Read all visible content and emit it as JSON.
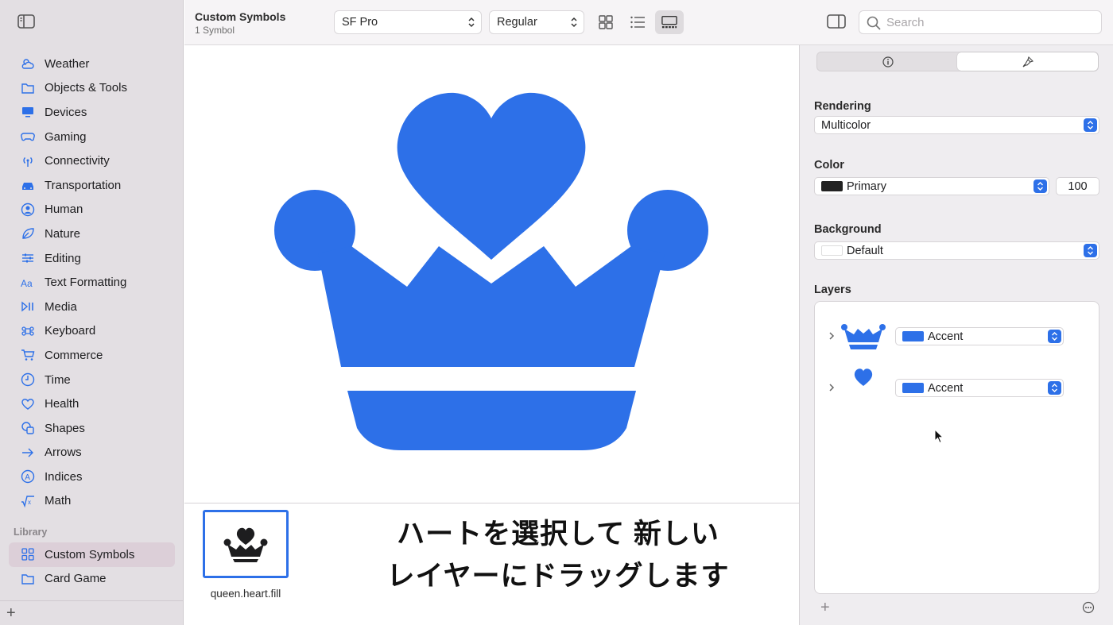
{
  "sidebar": {
    "categories": [
      {
        "label": "Weather",
        "icon": "cloud-sun-icon"
      },
      {
        "label": "Objects & Tools",
        "icon": "folder-icon"
      },
      {
        "label": "Devices",
        "icon": "desktop-icon"
      },
      {
        "label": "Gaming",
        "icon": "gamecontroller-icon"
      },
      {
        "label": "Connectivity",
        "icon": "antenna-icon"
      },
      {
        "label": "Transportation",
        "icon": "car-icon"
      },
      {
        "label": "Human",
        "icon": "person-circle-icon"
      },
      {
        "label": "Nature",
        "icon": "leaf-icon"
      },
      {
        "label": "Editing",
        "icon": "sliders-icon"
      },
      {
        "label": "Text Formatting",
        "icon": "text-aa-icon"
      },
      {
        "label": "Media",
        "icon": "play-pause-icon"
      },
      {
        "label": "Keyboard",
        "icon": "command-icon"
      },
      {
        "label": "Commerce",
        "icon": "cart-icon"
      },
      {
        "label": "Time",
        "icon": "clock-icon"
      },
      {
        "label": "Health",
        "icon": "heart-icon"
      },
      {
        "label": "Shapes",
        "icon": "shapes-icon"
      },
      {
        "label": "Arrows",
        "icon": "arrow-right-icon"
      },
      {
        "label": "Indices",
        "icon": "a-circle-icon"
      },
      {
        "label": "Math",
        "icon": "sqrt-icon"
      }
    ],
    "library_title": "Library",
    "library_items": [
      {
        "label": "Custom Symbols",
        "icon": "grid-icon",
        "selected": true
      },
      {
        "label": "Card Game",
        "icon": "folder-icon",
        "selected": false
      }
    ]
  },
  "toolbar": {
    "title": "Custom Symbols",
    "subtitle": "1 Symbol",
    "font_popup": "SF Pro",
    "weight_popup": "Regular",
    "search_placeholder": "Search"
  },
  "gallery": {
    "symbol_name": "queen.heart.fill",
    "caption_line1": "ハートを選択して 新しい",
    "caption_line2": "レイヤーにドラッグします"
  },
  "inspector": {
    "rendering_label": "Rendering",
    "rendering_value": "Multicolor",
    "color_label": "Color",
    "color_value": "Primary",
    "color_opacity": "100",
    "background_label": "Background",
    "background_value": "Default",
    "layers_label": "Layers",
    "layers": [
      {
        "color_name": "Accent",
        "icon": "crown-icon"
      },
      {
        "color_name": "Accent",
        "icon": "heart-icon"
      }
    ]
  },
  "colors": {
    "accent": "#2d70e8",
    "primary_swatch": "#222222"
  }
}
